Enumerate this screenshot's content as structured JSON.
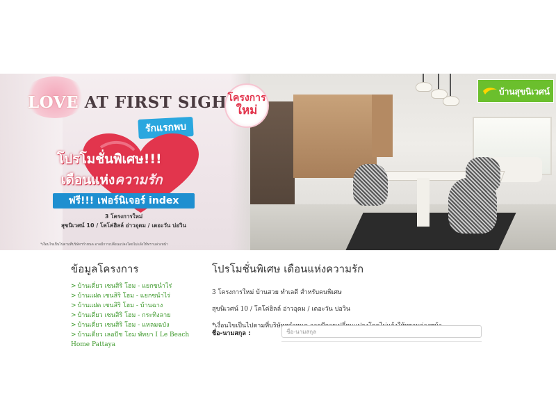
{
  "banner": {
    "title_love": "LOVE",
    "title_rest": " AT FIRST SIGHT",
    "badge_love_first_sight": "รักแรกพบ",
    "promo_line1": "โปรโมชั่นพิเศษ!!!",
    "promo_line2_a": "เดือนแห่ง",
    "promo_line2_b": "ความรัก",
    "free_furniture": "ฟรี!!! เฟอร์นิเจอร์ index",
    "project_count": "3 โครงการใหม่",
    "project_names": "สุขนิเวศน์ 10 / โคโค่ฮิลล์ อ่าวอุดม / เดอะวัน บ่อวิน",
    "disclaimer": "*เงื่อนไขเป็นไปตามที่บริษัทฯกำหนด อาจมีการเปลี่ยนแปลงโดยไม่แจ้งให้ทราบล่วงหน้า",
    "new_project_badge_l1": "โครงการ",
    "new_project_badge_l2": "ใหม่",
    "brand_name": "บ้านสุขนิเวศน์"
  },
  "left_column": {
    "title": "ข้อมูลโครงการ",
    "chevron": ">",
    "projects": [
      "บ้านเดี่ยว เซนสิริ โฮม - แยกซนำไร่",
      "บ้านแฝด เซนสิริ โฮม - แยกซนำไร่",
      "บ้านแฝด เซนสิริ โฮม - บ้านฉาง",
      "บ้านเดี่ยว เซนสิริ โฮม - กระทิงลาย",
      "บ้านเดี่ยว เซนสิริ โฮม - แหลมฉบัง",
      "บ้านเดี่ยว เลอบีช โฮม พัทยา I Le Beach Home Pattaya"
    ]
  },
  "right_column": {
    "title": "โปรโมชั่นพิเศษ เดือนแห่งความรัก",
    "line1": "3 โครงการใหม่ บ้านสวย ทำเลดี สำหรับคนพิเศษ",
    "line2": "สุขนิเวศน์ 10 / โคโค่ฮิลล์ อ่าวอุดม / เดอะวัน บ่อวิน",
    "line3": "*เงื่อนไขเป็นไปตามที่บริษัทฯกำหนด อาจมีการเปลี่ยนแปลงโดยไม่แจ้งให้ทราบล่วงหน้า",
    "form": {
      "name_label": "ชื่อ-นามสกุล :",
      "name_placeholder": "ชื่อ-นามสกุล",
      "name_value": ""
    }
  },
  "colors": {
    "link_green": "#3f9a2d",
    "brand_green": "#6bbf2d",
    "promo_blue": "#1e8fd0",
    "heart_red": "#e2354d"
  }
}
